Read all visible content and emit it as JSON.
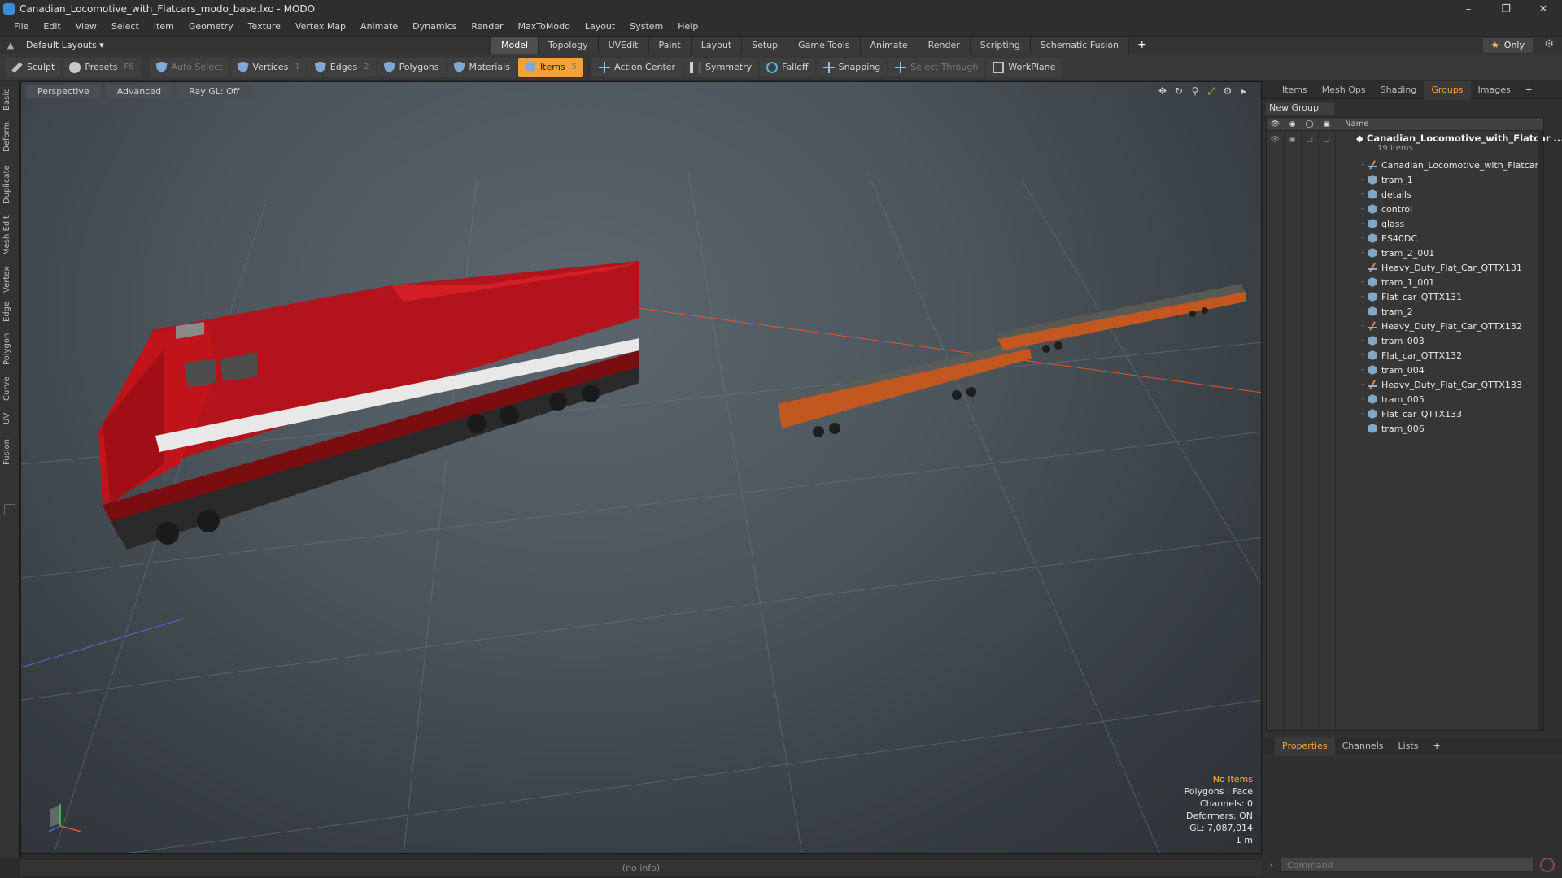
{
  "window": {
    "title": "Canadian_Locomotive_with_Flatcars_modo_base.lxo - MODO",
    "controls": [
      "–",
      "❐",
      "✕"
    ]
  },
  "menu": [
    "File",
    "Edit",
    "View",
    "Select",
    "Item",
    "Geometry",
    "Texture",
    "Vertex Map",
    "Animate",
    "Dynamics",
    "Render",
    "MaxToModo",
    "Layout",
    "System",
    "Help"
  ],
  "layout": {
    "selector": "Default Layouts ▾",
    "tabs": [
      "Model",
      "Topology",
      "UVEdit",
      "Paint",
      "Layout",
      "Setup",
      "Game Tools",
      "Animate",
      "Render",
      "Scripting",
      "Schematic Fusion"
    ],
    "active_tab": "Model",
    "add_tab": "+",
    "only_star": "★",
    "only_label": "Only",
    "settings_icon": "gear-icon"
  },
  "toolbar": {
    "sculpt": "Sculpt",
    "presets": "Presets",
    "presets_key": "F6",
    "auto_select": "Auto Select",
    "vertices": "Vertices",
    "vertices_key": "1",
    "edges": "Edges",
    "edges_key": "2",
    "polygons": "Polygons",
    "materials": "Materials",
    "items": "Items",
    "items_key": "5",
    "action_center": "Action Center",
    "symmetry": "Symmetry",
    "falloff": "Falloff",
    "snapping": "Snapping",
    "select_through": "Select Through",
    "workplane": "WorkPlane",
    "accent_color": "#f2a23c"
  },
  "left_tabs": [
    "Basic",
    "Deform",
    "Duplicate",
    "Mesh Edit",
    "Vertex",
    "Edge",
    "Polygon",
    "Curve",
    "UV",
    "Fusion"
  ],
  "viewport": {
    "view": "Perspective",
    "shading": "Advanced",
    "raygl": "Ray GL: Off",
    "info": {
      "selection": "No Items",
      "polygons": "Polygons : Face",
      "channels": "Channels: 0",
      "deformers": "Deformers: ON",
      "gl": "GL: 7,087,014",
      "scale": "1 m"
    },
    "locomotive_color": "#c0141a",
    "flatcar_color": "#c2581f"
  },
  "status": "(no info)",
  "right_panel": {
    "tabs": [
      "Items",
      "Mesh Ops",
      "Shading",
      "Groups",
      "Images"
    ],
    "active_tab": "Groups",
    "new_group": "New Group",
    "name_header": "Name",
    "root_name": "Canadian_Locomotive_with_Flatcar ...",
    "root_count": "19 Items",
    "items": [
      {
        "name": "Canadian_Locomotive_with_Flatcars",
        "icon": "locator"
      },
      {
        "name": "tram_1",
        "icon": "mesh"
      },
      {
        "name": "details",
        "icon": "mesh"
      },
      {
        "name": "control",
        "icon": "mesh"
      },
      {
        "name": "glass",
        "icon": "mesh"
      },
      {
        "name": "ES40DC",
        "icon": "mesh"
      },
      {
        "name": "tram_2_001",
        "icon": "mesh"
      },
      {
        "name": "Heavy_Duty_Flat_Car_QTTX131",
        "icon": "locator"
      },
      {
        "name": "tram_1_001",
        "icon": "mesh"
      },
      {
        "name": "Flat_car_QTTX131",
        "icon": "mesh"
      },
      {
        "name": "tram_2",
        "icon": "mesh"
      },
      {
        "name": "Heavy_Duty_Flat_Car_QTTX132",
        "icon": "locator"
      },
      {
        "name": "tram_003",
        "icon": "mesh"
      },
      {
        "name": "Flat_car_QTTX132",
        "icon": "mesh"
      },
      {
        "name": "tram_004",
        "icon": "mesh"
      },
      {
        "name": "Heavy_Duty_Flat_Car_QTTX133",
        "icon": "locator"
      },
      {
        "name": "tram_005",
        "icon": "mesh"
      },
      {
        "name": "Flat_car_QTTX133",
        "icon": "mesh"
      },
      {
        "name": "tram_006",
        "icon": "mesh"
      }
    ],
    "bottom_tabs": [
      "Properties",
      "Channels",
      "Lists"
    ],
    "bottom_active": "Properties",
    "command_placeholder": "Command"
  }
}
